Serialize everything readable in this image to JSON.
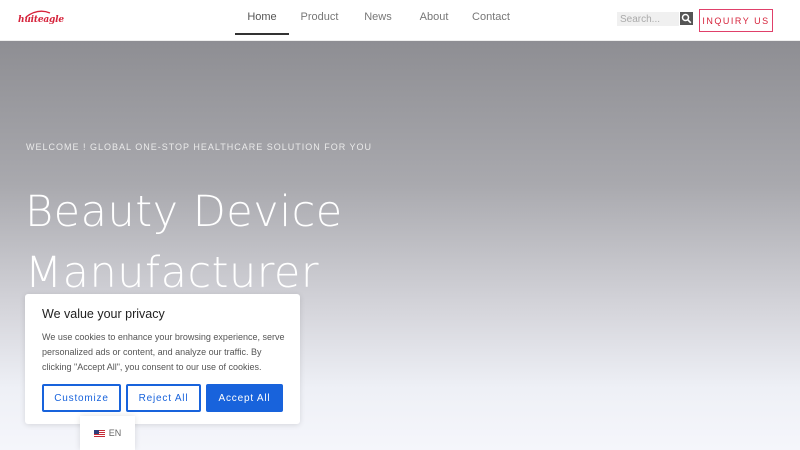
{
  "header": {
    "logo_text": "huiteagle",
    "nav": [
      {
        "label": "Home",
        "active": true
      },
      {
        "label": "Product",
        "active": false
      },
      {
        "label": "News",
        "active": false
      },
      {
        "label": "About",
        "active": false
      },
      {
        "label": "Contact",
        "active": false
      }
    ],
    "search_placeholder": "Search...",
    "inquiry_label": "INQUIRY US",
    "accent_color": "#d6233b"
  },
  "hero": {
    "eyebrow": "WELCOME ! GLOBAL ONE-STOP HEALTHCARE SOLUTION FOR YOU",
    "title_line1": "Beauty Device",
    "title_line2": "Manufacturer"
  },
  "cookie": {
    "title": "We value your privacy",
    "text": "We use cookies to enhance your browsing experience, serve personalized ads or content, and analyze our traffic. By clicking \"Accept All\", you consent to our use of cookies.",
    "customize_label": "Customize",
    "reject_label": "Reject All",
    "accept_label": "Accept All",
    "button_color": "#1863dc"
  },
  "language": {
    "label": "EN",
    "flag_icon": "us-flag-icon"
  }
}
